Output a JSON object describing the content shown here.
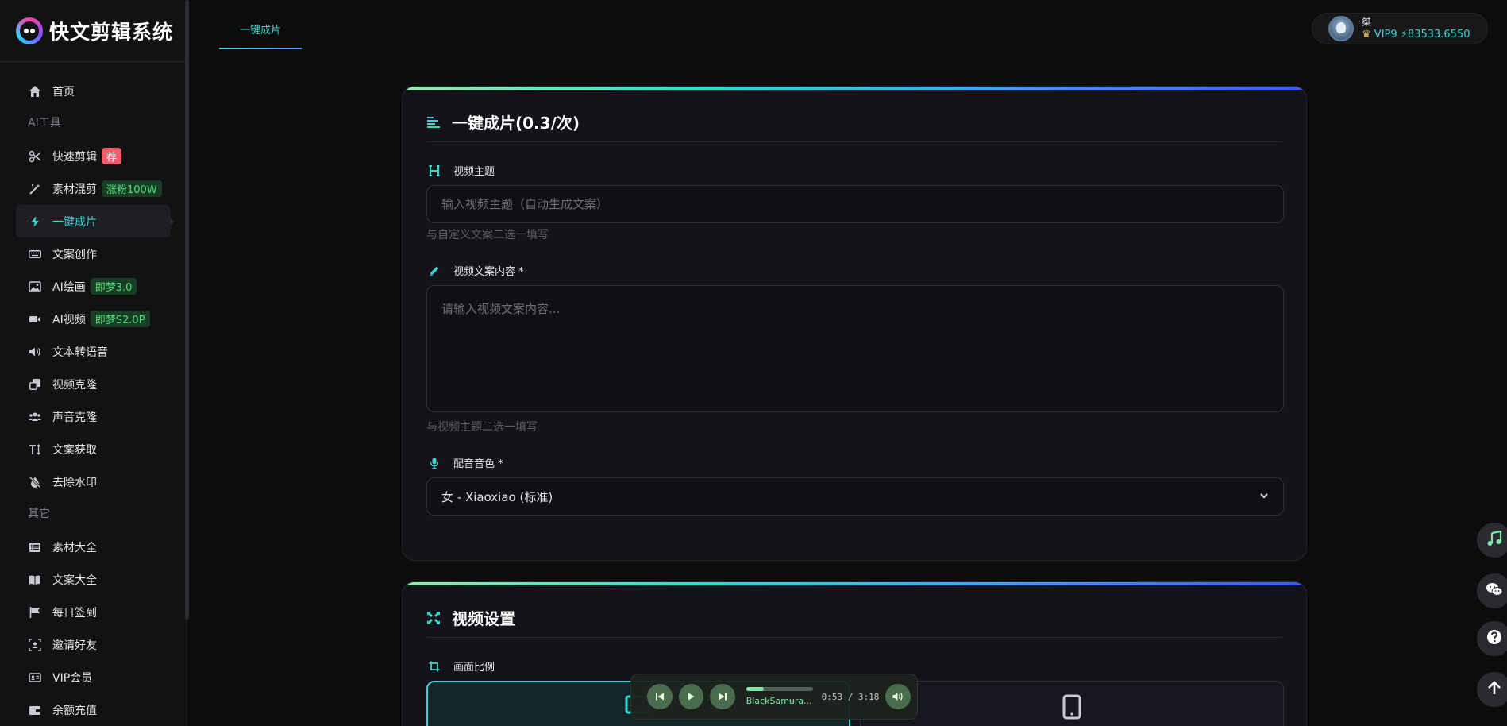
{
  "brand": {
    "title": "快文剪辑系统",
    "logo_text": "◉◉"
  },
  "nav": {
    "home": "首页",
    "section_ai": "AI工具",
    "quick_edit": "快速剪辑",
    "quick_edit_badge": "荐",
    "mix": "素材混剪",
    "mix_badge": "涨粉100W",
    "one_click": "一键成片",
    "copywriting": "文案创作",
    "ai_draw": "AI绘画",
    "ai_draw_badge": "即梦3.0",
    "ai_video": "AI视频",
    "ai_video_badge": "即梦S2.0P",
    "tts": "文本转语音",
    "video_clone": "视频克隆",
    "voice_clone": "声音克隆",
    "text_extract": "文案获取",
    "watermark": "去除水印",
    "section_other": "其它",
    "materials": "素材大全",
    "copy_library": "文案大全",
    "checkin": "每日签到",
    "invite": "邀请好友",
    "vip": "VIP会员",
    "recharge": "余额充值"
  },
  "header": {
    "tab_label": "一键成片",
    "user_name": "桀",
    "vip_level": "VIP9",
    "balance": "83533.6550"
  },
  "card1": {
    "title": "一键成片(0.3/次)",
    "topic_label": "视频主题",
    "topic_placeholder": "输入视频主题（自动生成文案）",
    "topic_hint": "与自定义文案二选一填写",
    "content_label": "视频文案内容 *",
    "content_placeholder": "请输入视频文案内容...",
    "content_hint": "与视频主题二选一填写",
    "voice_label": "配音音色 *",
    "voice_selected": "女 - Xiaoxiao (标准)"
  },
  "card2": {
    "title": "视频设置",
    "ratio_label": "画面比例"
  },
  "player": {
    "title": "BlackSamura...",
    "time": "0:53 / 3:18",
    "progress": 0.27
  },
  "colors": {
    "accent": "#36d7d1",
    "badge_red": "#f25d6b",
    "badge_green": "#4ee07a"
  }
}
